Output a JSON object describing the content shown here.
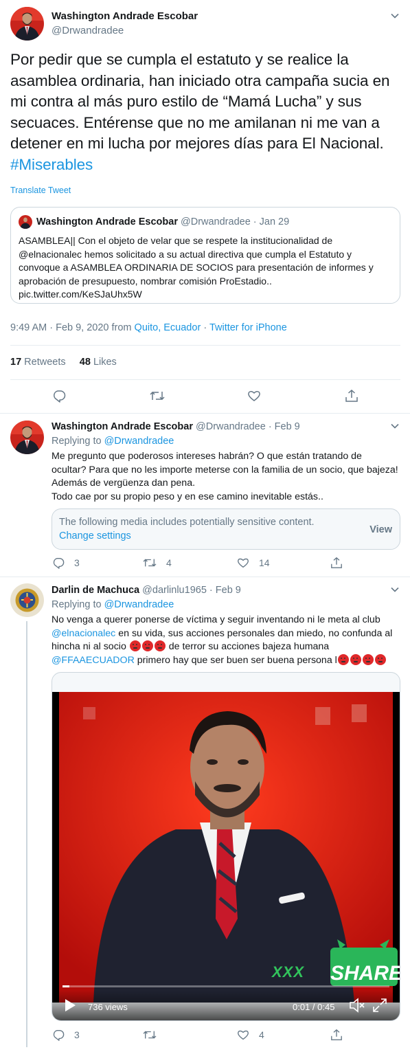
{
  "main_tweet": {
    "author_name": "Washington Andrade Escobar",
    "author_handle": "@Drwandradee",
    "text": "Por pedir que se cumpla el estatuto y se realice la asamblea ordinaria, han iniciado otra campaña sucia en mi contra al más puro estilo de “Mamá Lucha” y sus secuaces. Entérense que no me amilanan ni me van a detener en mi lucha por mejores días para El Nacional.",
    "hashtag": "#Miserables",
    "translate_label": "Translate Tweet",
    "quoted": {
      "author_name": "Washington Andrade Escobar",
      "meta": "@Drwandradee · Jan 29",
      "text": "ASAMBLEA|| Con el objeto de velar que se respete la institucionalidad de @elnacionalec hemos solicitado a su actual directiva que cumpla el Estatuto y convoque a ASAMBLEA ORDINARIA DE SOCIOS para presentación de informes y aprobación de presupuesto, nombrar comisión ProEstadio..",
      "link": "pic.twitter.com/KeSJaUhx5W"
    },
    "time": "9:49 AM · Feb 9, 2020 from",
    "location": "Quito, Ecuador",
    "separator": "·",
    "client": "Twitter for iPhone",
    "retweets_count": "17",
    "retweets_label": "Retweets",
    "likes_count": "48",
    "likes_label": "Likes"
  },
  "reply1": {
    "author_name": "Washington Andrade Escobar",
    "meta": "@Drwandradee · Feb 9",
    "replying_to_label": "Replying to",
    "replying_to_handle": "@Drwandradee",
    "text": "Me pregunto que poderosos intereses habrán? O que están tratando de ocultar? Para que no les importe meterse con la familia de un socio, que bajeza! Además de vergüenza dan pena.",
    "text2": "Todo cae por su propio peso y en ese camino inevitable estás..",
    "sensitive_text": "The following media includes potentially sensitive content.",
    "change_settings": "Change settings",
    "view_label": "View",
    "replies": "3",
    "retweets": "4",
    "likes": "14"
  },
  "reply2": {
    "author_name": "Darlin de Machuca",
    "meta": "@darlinlu1965 · Feb 9",
    "replying_to_label": "Replying to",
    "replying_to_handle": "@Drwandradee",
    "text_a": "No venga a querer ponerse de víctima y seguir inventando ni le meta al club",
    "mention1": "@elnacionalec",
    "text_b": "en su vida, sus acciones personales dan miedo, no confunda al hincha ni al socio",
    "text_c": "de terror su acciones bajeza humana",
    "mention2": "@FFAAECUADOR",
    "text_d": "primero hay que ser buen ser buena persona l",
    "video": {
      "views": "736 views",
      "time": "0:01 / 0:45",
      "progress": 0.022,
      "overlay_text": "XXX",
      "share_text": "SHARE"
    },
    "replies": "3",
    "retweets": "",
    "likes": "4"
  },
  "colors": {
    "link": "#1b95e0",
    "muted": "#657786",
    "border": "#ccd6dd",
    "video_bg": "#d51a10"
  },
  "icons": [
    "chevron-down-icon",
    "reply-icon",
    "retweet-icon",
    "like-icon",
    "share-icon",
    "play-icon",
    "volume-icon",
    "fullscreen-icon"
  ]
}
